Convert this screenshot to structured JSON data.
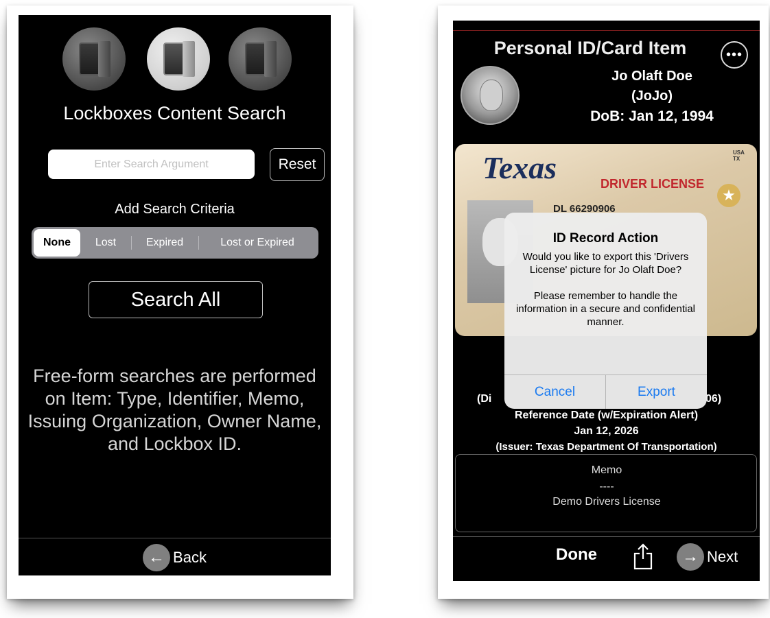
{
  "left": {
    "title": "Lockboxes Content Search",
    "search": {
      "placeholder": "Enter Search Argument",
      "value": ""
    },
    "reset_label": "Reset",
    "criteria_label": "Add Search Criteria",
    "criteria_options": [
      "None",
      "Lost",
      "Expired",
      "Lost or Expired"
    ],
    "criteria_selected": "None",
    "search_all_label": "Search All",
    "help_text": "Free-form searches are performed on Item: Type, Identifier, Memo, Issuing Organization, Owner Name, and Lockbox ID.",
    "footer": {
      "back_icon": "←",
      "back_label": "Back"
    }
  },
  "right": {
    "title": "Personal ID/Card Item",
    "more_icon": "•••",
    "owner": {
      "name": "Jo Olaft Doe",
      "nickname": "(JoJo)",
      "dob": "DoB: Jan 12, 1994"
    },
    "license": {
      "state": "Texas",
      "type": "DRIVER LICENSE",
      "number": "DL 66290906",
      "usa": "USA\nTX"
    },
    "dialog": {
      "title": "ID Record Action",
      "message": "Would you like to export this 'Drivers License' picture for Jo Olaft Doe?\n\nPlease remember to handle the information in a secure and confidential manner.",
      "cancel_label": "Cancel",
      "export_label": "Export"
    },
    "info": {
      "identifier_left": "(Di",
      "identifier_right": "06)",
      "reference_label": "Reference Date (w/Expiration Alert)",
      "reference_date": "Jan 12, 2026",
      "issuer": "(Issuer: Texas Department Of Transportation)"
    },
    "memo": {
      "label": "Memo",
      "separator": "----",
      "text": "Demo Drivers License"
    },
    "footer": {
      "done_label": "Done",
      "next_icon": "→",
      "next_label": "Next"
    }
  },
  "colors": {
    "accent": "#1a7af0",
    "background": "#000000"
  }
}
